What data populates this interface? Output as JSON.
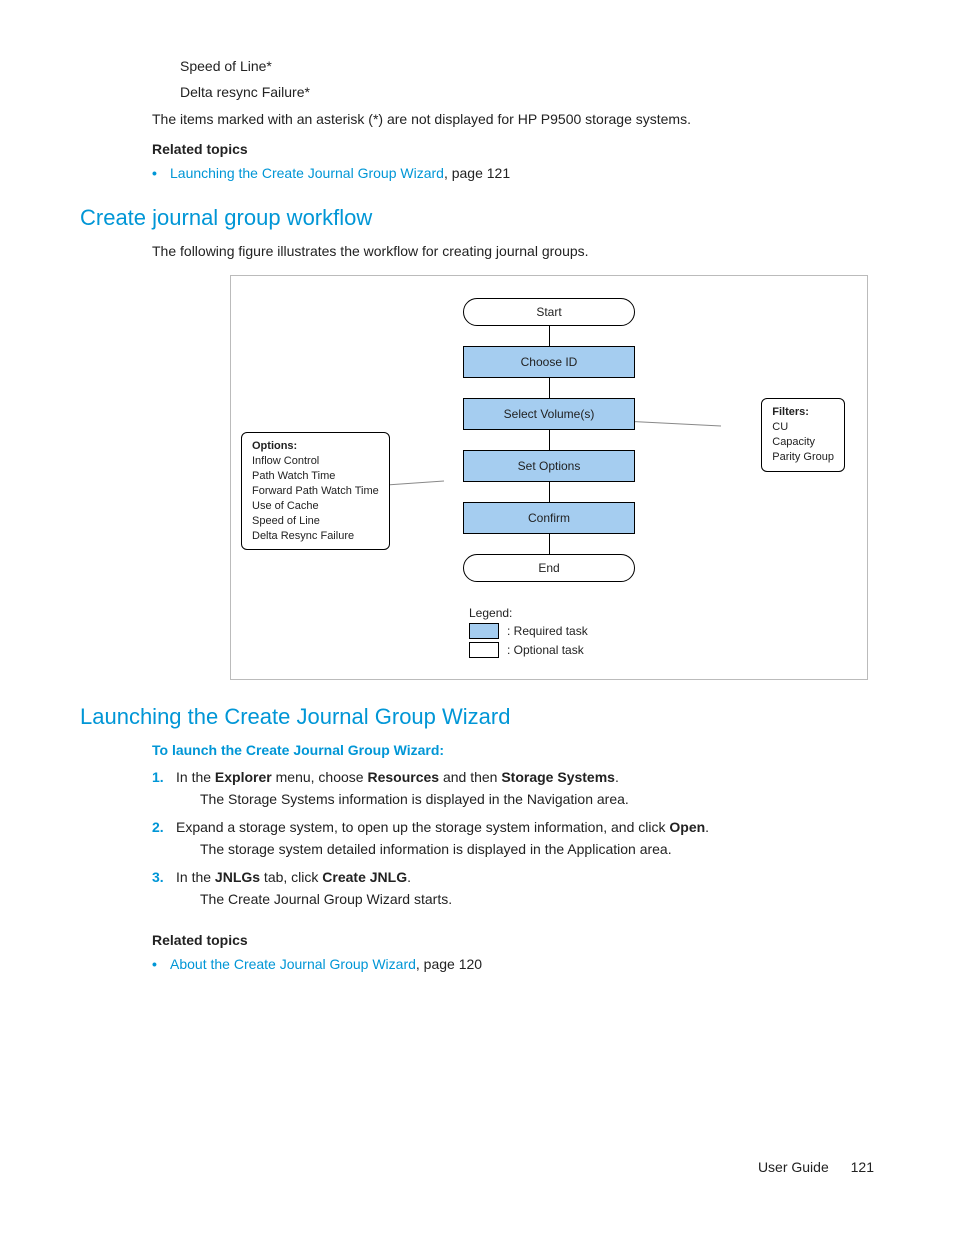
{
  "top": {
    "line1": "Speed of Line*",
    "line2": "Delta resync Failure*",
    "asterisk_note": "The items marked with an asterisk (*) are not displayed for HP P9500 storage systems."
  },
  "related1": {
    "heading": "Related topics",
    "link_text": "Launching the Create Journal Group Wizard",
    "page_suffix": ", page 121"
  },
  "section_workflow": {
    "title": "Create journal group workflow",
    "intro": "The following figure illustrates the workflow for creating journal groups."
  },
  "diagram": {
    "start": "Start",
    "choose_id": "Choose ID",
    "select_volumes": "Select Volume(s)",
    "set_options": "Set Options",
    "confirm": "Confirm",
    "end": "End",
    "filters_title": "Filters:",
    "filters_lines": [
      "CU",
      "Capacity",
      "Parity Group"
    ],
    "options_title": "Options:",
    "options_lines": [
      "Inflow Control",
      "Path Watch Time",
      "Forward Path Watch Time",
      "Use of Cache",
      "Speed of Line",
      "Delta Resync Failure"
    ],
    "legend_label": "Legend:",
    "legend_required": ": Required task",
    "legend_optional": ": Optional task"
  },
  "section_launch": {
    "title": "Launching the Create Journal Group Wizard",
    "subhead": "To launch the Create Journal Group Wizard:",
    "steps": [
      {
        "num": "1.",
        "pre": "In the ",
        "b1": "Explorer",
        "mid1": " menu, choose ",
        "b2": "Resources",
        "mid2": " and then ",
        "b3": "Storage Systems",
        "post": ".",
        "sub": "The Storage Systems information is displayed in the Navigation area."
      },
      {
        "num": "2.",
        "pre": "Expand a storage system, to open up the storage system information, and click ",
        "b1": "Open",
        "post": ".",
        "sub": "The storage system detailed information is displayed in the Application area."
      },
      {
        "num": "3.",
        "pre": "In the ",
        "b1": "JNLGs",
        "mid1": " tab, click ",
        "b2": "Create JNLG",
        "post": ".",
        "sub": "The Create Journal Group Wizard starts."
      }
    ]
  },
  "related2": {
    "heading": "Related topics",
    "link_text": "About the Create Journal Group Wizard",
    "page_suffix": ", page 120"
  },
  "footer": {
    "label": "User Guide",
    "page": "121"
  }
}
